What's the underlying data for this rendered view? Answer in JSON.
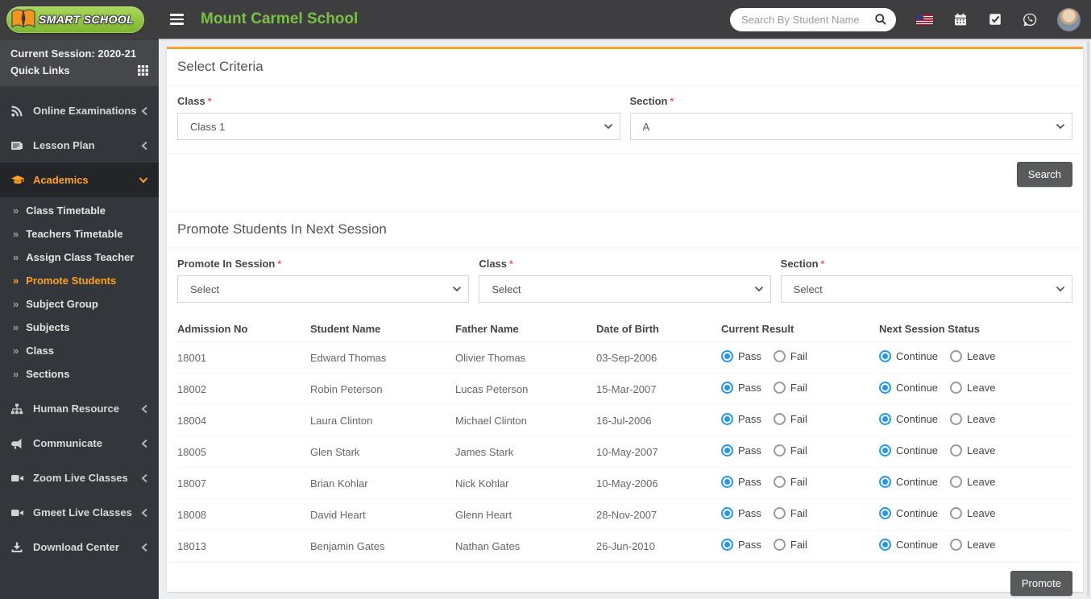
{
  "header": {
    "logo_text": "SMART SCHOOL",
    "title": "Mount Carmel School",
    "search": {
      "placeholder": "Search By Student Name"
    }
  },
  "sidebar": {
    "current_session": "Current Session: 2020-21",
    "quick_links": "Quick Links",
    "menu": [
      {
        "label": "Online Examinations",
        "icon": "rss-icon",
        "state": "collapsed"
      },
      {
        "label": "Lesson Plan",
        "icon": "lesson-plan-icon",
        "state": "collapsed"
      },
      {
        "label": "Academics",
        "icon": "graduation-cap-icon",
        "state": "expanded",
        "active": true,
        "children": [
          {
            "label": "Class Timetable"
          },
          {
            "label": "Teachers Timetable"
          },
          {
            "label": "Assign Class Teacher"
          },
          {
            "label": "Promote Students",
            "active": true
          },
          {
            "label": "Subject Group"
          },
          {
            "label": "Subjects"
          },
          {
            "label": "Class"
          },
          {
            "label": "Sections"
          }
        ]
      },
      {
        "label": "Human Resource",
        "icon": "sitemap-icon",
        "state": "collapsed"
      },
      {
        "label": "Communicate",
        "icon": "bullhorn-icon",
        "state": "collapsed"
      },
      {
        "label": "Zoom Live Classes",
        "icon": "video-icon",
        "state": "collapsed"
      },
      {
        "label": "Gmeet Live Classes",
        "icon": "video-icon",
        "state": "collapsed"
      },
      {
        "label": "Download Center",
        "icon": "download-icon",
        "state": "collapsed"
      }
    ]
  },
  "select_criteria": {
    "title": "Select Criteria",
    "class_label": "Class",
    "class_value": "Class 1",
    "section_label": "Section",
    "section_value": "A",
    "search_button": "Search"
  },
  "promote_section": {
    "title": "Promote Students In Next Session",
    "session_label": "Promote In Session",
    "session_value": "Select",
    "class_label": "Class",
    "class_value": "Select",
    "section_label": "Section",
    "section_value": "Select",
    "promote_button": "Promote",
    "table": {
      "columns": [
        "Admission No",
        "Student Name",
        "Father Name",
        "Date of Birth",
        "Current Result",
        "Next Session Status"
      ],
      "result_options": [
        "Pass",
        "Fail"
      ],
      "status_options": [
        "Continue",
        "Leave"
      ],
      "rows": [
        {
          "admission_no": "18001",
          "student_name": "Edward Thomas",
          "father_name": "Olivier Thomas",
          "dob": "03-Sep-2006",
          "current_result": "Pass",
          "next_session_status": "Continue"
        },
        {
          "admission_no": "18002",
          "student_name": "Robin Peterson",
          "father_name": "Lucas Peterson",
          "dob": "15-Mar-2007",
          "current_result": "Pass",
          "next_session_status": "Continue"
        },
        {
          "admission_no": "18004",
          "student_name": "Laura Clinton",
          "father_name": "Michael Clinton",
          "dob": "16-Jul-2006",
          "current_result": "Pass",
          "next_session_status": "Continue"
        },
        {
          "admission_no": "18005",
          "student_name": "Glen Stark",
          "father_name": "James Stark",
          "dob": "10-May-2007",
          "current_result": "Pass",
          "next_session_status": "Continue"
        },
        {
          "admission_no": "18007",
          "student_name": "Brian Kohlar",
          "father_name": "Nick Kohlar",
          "dob": "10-May-2006",
          "current_result": "Pass",
          "next_session_status": "Continue"
        },
        {
          "admission_no": "18008",
          "student_name": "David Heart",
          "father_name": "Glenn Heart",
          "dob": "28-Nov-2007",
          "current_result": "Pass",
          "next_session_status": "Continue"
        },
        {
          "admission_no": "18013",
          "student_name": "Benjamin Gates",
          "father_name": "Nathan Gates",
          "dob": "26-Jun-2010",
          "current_result": "Pass",
          "next_session_status": "Continue"
        }
      ]
    }
  },
  "colors": {
    "accent_orange": "#ffa21d",
    "brand_green": "#7ac143",
    "radio_blue": "#2196f3",
    "button_gray": "#595a5c",
    "header_dark": "#3e3e40",
    "sidebar_dark": "#33363a"
  }
}
